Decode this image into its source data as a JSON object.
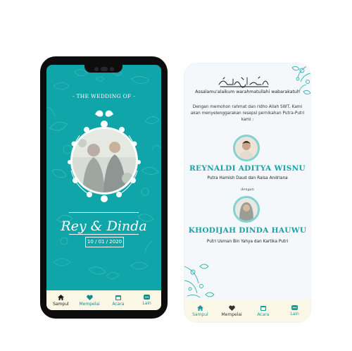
{
  "cover": {
    "subtitle": "- THE WEDDING OF -",
    "couple_names": "Rey & Dinda",
    "date": "10 / 01 / 2020"
  },
  "phone_nav": [
    {
      "label": "Sampul",
      "icon": "home-icon"
    },
    {
      "label": "Mempelai",
      "icon": "heart-icon"
    },
    {
      "label": "Acara",
      "icon": "calendar-icon"
    },
    {
      "label": "Lain",
      "icon": "more-icon"
    }
  ],
  "card": {
    "greeting": "Assalamu'alaikum warahmatullahi wabarakatuh",
    "intro": "Dengan memohon rahmat dan ridho Allah SWT, Kami akan menyelenggarakan resepsi pernikahan Putra-Putri kami :",
    "groom_name": "REYNALDI ADITYA WISNU",
    "groom_parents": "Putra Hamish Daud dan Raisa Andriana",
    "connector": "dengan",
    "bride_name": "KHODIJAH DINDA HAUWU",
    "bride_parents": "Putri Usman Bin Yahya dan Kartika Putri"
  },
  "card_nav": [
    {
      "label": "Sampul",
      "icon": "home-icon"
    },
    {
      "label": "Mempelai",
      "icon": "heart-icon"
    },
    {
      "label": "Acara",
      "icon": "calendar-icon"
    },
    {
      "label": "Lain",
      "icon": "more-icon"
    }
  ],
  "colors": {
    "teal": "#0fa5a9",
    "accent_text": "#16a3a6",
    "nav_background": "#fbf7e6",
    "phone_body": "#0d0d0d"
  }
}
